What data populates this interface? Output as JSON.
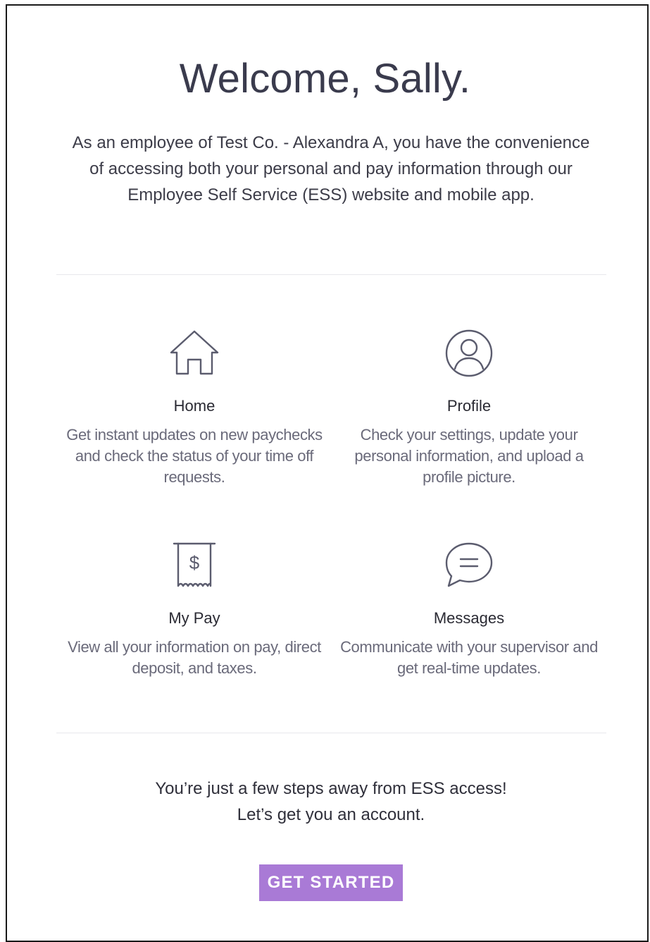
{
  "header": {
    "title": "Welcome, Sally."
  },
  "intro": {
    "text": "As an employee of Test Co. - Alexandra A, you have the convenience of accessing both your personal and pay information through our Employee Self Service (ESS) website and mobile app."
  },
  "features": [
    {
      "icon": "home-icon",
      "title": "Home",
      "description": "Get instant updates on new paychecks and check the status of your time off requests."
    },
    {
      "icon": "user-circle-icon",
      "title": "Profile",
      "description": "Check your settings, update your personal information, and upload a profile picture."
    },
    {
      "icon": "receipt-dollar-icon",
      "title": "My Pay",
      "description": "View all your information on pay, direct deposit, and taxes."
    },
    {
      "icon": "chat-bubble-icon",
      "title": "Messages",
      "description": "Communicate with your supervisor and get real-time updates."
    }
  ],
  "cta": {
    "line1": "You’re just a few steps away from ESS access!",
    "line2": "Let’s get you an account.",
    "button_label": "GET STARTED"
  },
  "colors": {
    "accent": "#a97ad6",
    "icon_stroke": "#5b5c6e",
    "title_text": "#3a3b4d",
    "body_text": "#6a6a7a"
  }
}
